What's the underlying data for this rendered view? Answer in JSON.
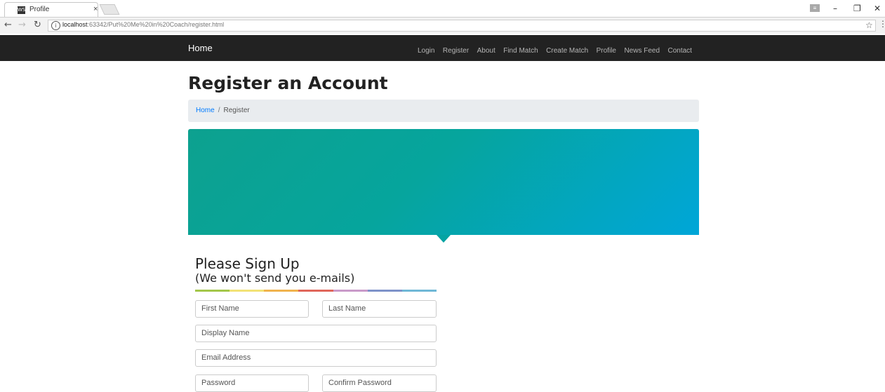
{
  "browser": {
    "tab_title": "Profile",
    "favicon_text": "WS",
    "tab_close": "×",
    "url_host": "localhost",
    "url_rest": ":63342/Put%20Me%20in%20Coach/register.html",
    "window_controls": {
      "minimize": "–",
      "maximize": "❐",
      "close": "✕"
    }
  },
  "navbar": {
    "brand": "Home",
    "links": [
      "Login",
      "Register",
      "About",
      "Find Match",
      "Create Match",
      "Profile",
      "News Feed",
      "Contact"
    ]
  },
  "page": {
    "title": "Register an Account",
    "breadcrumb": {
      "home": "Home",
      "separator": "/",
      "current": "Register"
    }
  },
  "banner": {
    "gradient_start": "#0da18f",
    "gradient_end": "#00a6d8"
  },
  "form": {
    "heading": "Please Sign Up",
    "subheading": "(We won't send you e-mails)",
    "colorbar": [
      "#a3c74a",
      "#f2e276",
      "#f0b34d",
      "#e0665a",
      "#c99ac9",
      "#7e93c9",
      "#6fb8d6"
    ],
    "fields": {
      "first_name": "First Name",
      "last_name": "Last Name",
      "display_name": "Display Name",
      "email": "Email Address",
      "password": "Password",
      "confirm_password": "Confirm Password"
    }
  }
}
